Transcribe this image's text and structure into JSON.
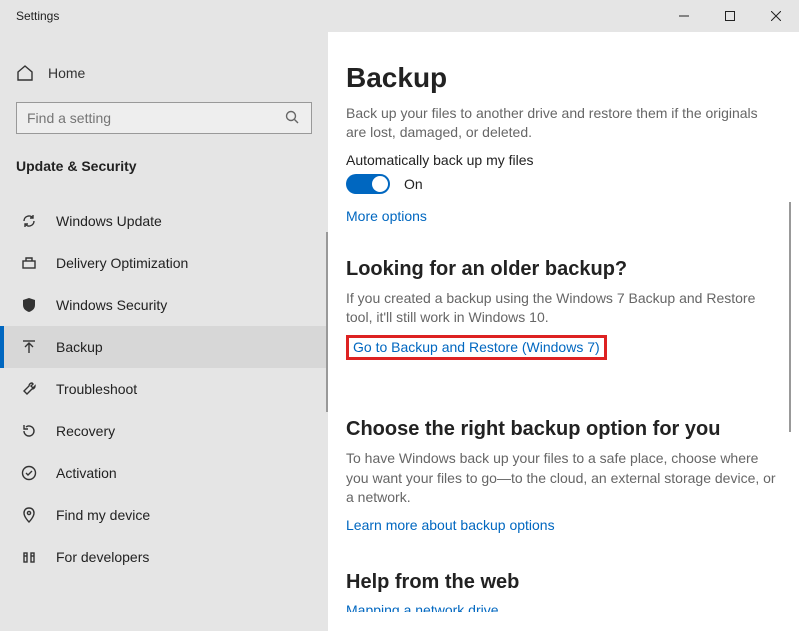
{
  "window": {
    "title": "Settings"
  },
  "sidebar": {
    "home_label": "Home",
    "search_placeholder": "Find a setting",
    "section_title": "Update & Security",
    "items": [
      {
        "label": "Windows Update"
      },
      {
        "label": "Delivery Optimization"
      },
      {
        "label": "Windows Security"
      },
      {
        "label": "Backup"
      },
      {
        "label": "Troubleshoot"
      },
      {
        "label": "Recovery"
      },
      {
        "label": "Activation"
      },
      {
        "label": "Find my device"
      },
      {
        "label": "For developers"
      }
    ]
  },
  "main": {
    "title": "Backup",
    "intro": "Back up your files to another drive and restore them if the originals are lost, damaged, or deleted.",
    "toggle_heading": "Automatically back up my files",
    "toggle_state_label": "On",
    "more_options": "More options",
    "older": {
      "title": "Looking for an older backup?",
      "body": "If you created a backup using the Windows 7 Backup and Restore tool, it'll still work in Windows 10.",
      "link": "Go to Backup and Restore (Windows 7)"
    },
    "choose": {
      "title": "Choose the right backup option for you",
      "body": "To have Windows back up your files to a safe place, choose where you want your files to go—to the cloud, an external storage device, or a network.",
      "link": "Learn more about backup options"
    },
    "help": {
      "title": "Help from the web",
      "link_cut": "Mapping a network drive"
    }
  }
}
